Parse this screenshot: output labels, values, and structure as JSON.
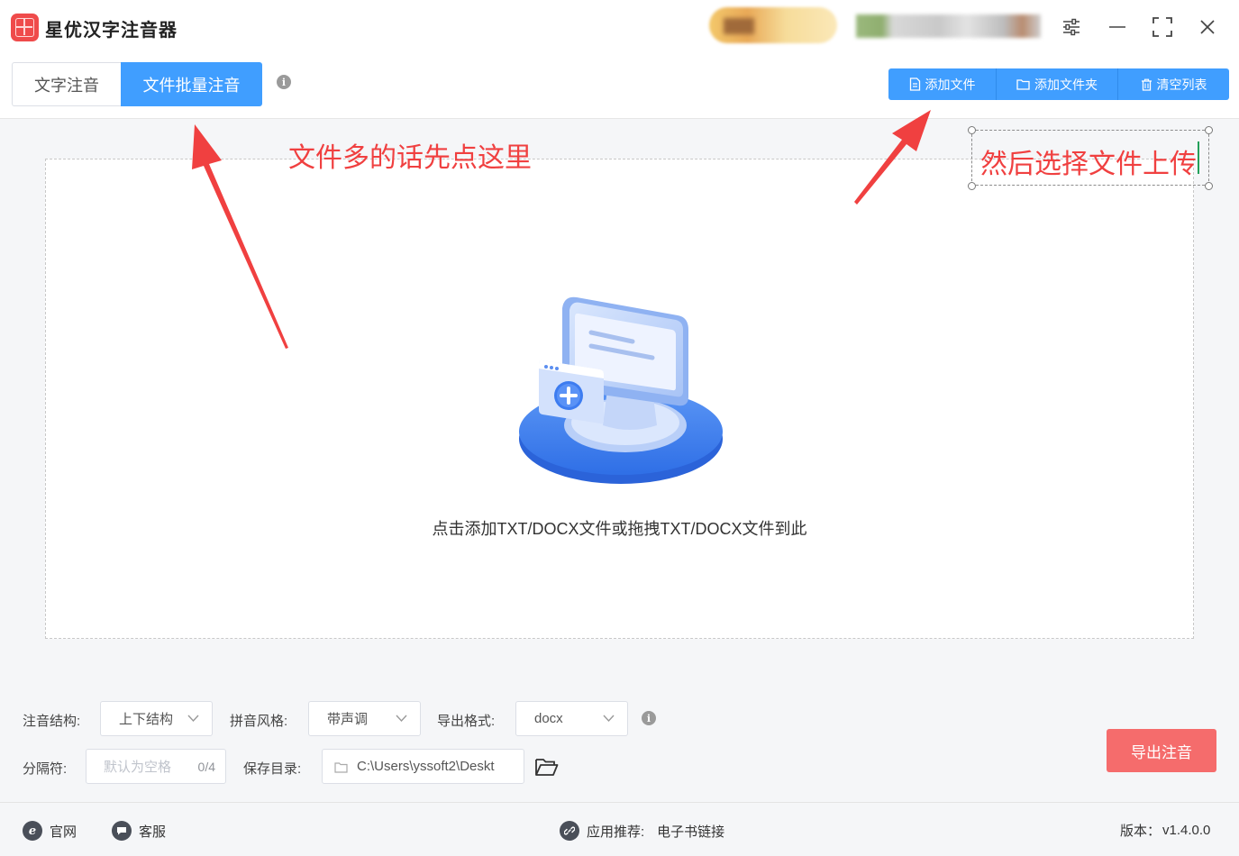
{
  "app": {
    "title": "星优汉字注音器",
    "version_label": "版本：",
    "version": "v1.4.0.0"
  },
  "tabs": [
    {
      "label": "文字注音",
      "active": false
    },
    {
      "label": "文件批量注音",
      "active": true
    }
  ],
  "toolbar": {
    "add_file": "添加文件",
    "add_folder": "添加文件夹",
    "clear_list": "清空列表"
  },
  "dropzone": {
    "hint": "点击添加TXT/DOCX文件或拖拽TXT/DOCX文件到此"
  },
  "options": {
    "structure_label": "注音结构:",
    "structure_value": "上下结构",
    "pinyin_label": "拼音风格:",
    "pinyin_value": "带声调",
    "format_label": "导出格式:",
    "format_value": "docx",
    "separator_label": "分隔符:",
    "separator_placeholder": "默认为空格",
    "separator_count": "0/4",
    "save_dir_label": "保存目录:",
    "save_dir_value": "C:\\Users\\yssoft2\\Deskt"
  },
  "export_button": "导出注音",
  "footer": {
    "website": "官网",
    "service": "客服",
    "recommend_label": "应用推荐:",
    "recommend_link": "电子书链接"
  },
  "annotations": {
    "note1": "文件多的话先点这里",
    "note2": "然后选择文件上传"
  },
  "colors": {
    "primary": "#409eff",
    "export": "#f56c6c",
    "annotation": "#f04040"
  },
  "icons": {
    "settings": "sliders-icon",
    "minimize": "minimize-icon",
    "maximize": "fullscreen-icon",
    "close": "close-icon",
    "folder": "folder-open-icon"
  }
}
